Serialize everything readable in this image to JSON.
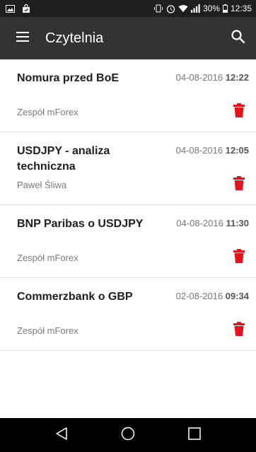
{
  "status_bar": {
    "icons_left": [
      "image-icon",
      "shopping-bag-icon"
    ],
    "icons_right": [
      "vibrate-icon",
      "alarm-icon",
      "wifi-icon",
      "signal-icon",
      "battery-icon"
    ],
    "battery_percent": "30%",
    "time": "12:35"
  },
  "app_bar": {
    "title": "Czytelnia",
    "menu_icon": "hamburger-menu-icon",
    "search_icon": "search-icon",
    "background": "#333333"
  },
  "articles": [
    {
      "title": "Nomura przed BoE",
      "date": "04-08-2016",
      "time": "12:22",
      "author": "Zespół mForex"
    },
    {
      "title": "USDJPY - analiza techniczna",
      "date": "04-08-2016",
      "time": "12:05",
      "author": "Paweł Śliwa"
    },
    {
      "title": "BNP Paribas o USDJPY",
      "date": "04-08-2016",
      "time": "11:30",
      "author": "Zespół mForex"
    },
    {
      "title": "Commerzbank o GBP",
      "date": "02-08-2016",
      "time": "09:34",
      "author": "Zespół mForex"
    }
  ],
  "colors": {
    "accent": "#e3131b",
    "nav_bar": "#000000",
    "status_bar": "#1f1f1f"
  },
  "nav_bar": {
    "buttons": [
      "back-icon",
      "home-icon",
      "recents-icon"
    ]
  }
}
